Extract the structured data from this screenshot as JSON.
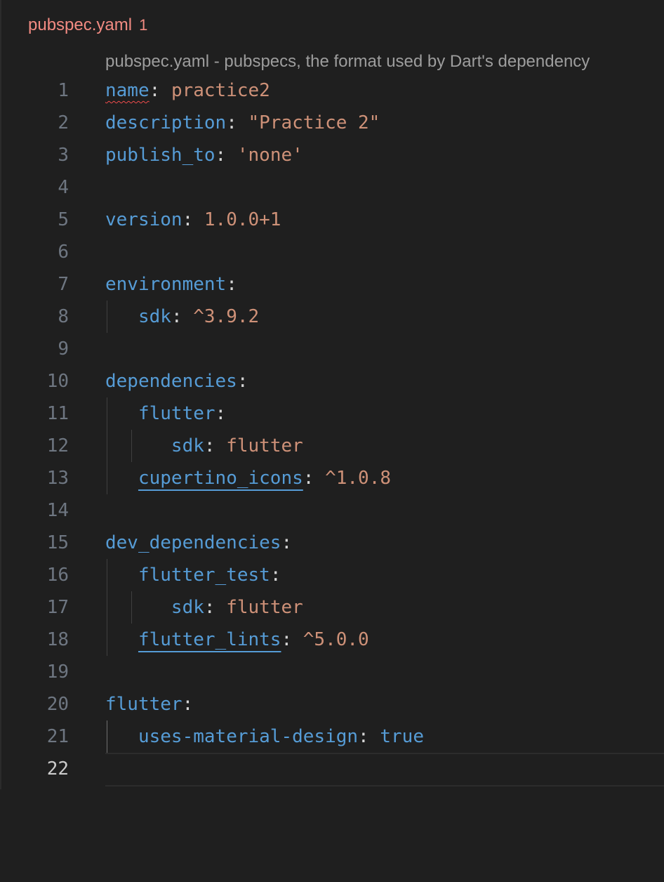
{
  "tab": {
    "filename": "pubspec.yaml",
    "problem_count": "1"
  },
  "schema_hint": "pubspec.yaml - pubspecs, the format used by Dart's dependency",
  "lines": [
    {
      "num": "1"
    },
    {
      "num": "2"
    },
    {
      "num": "3"
    },
    {
      "num": "4"
    },
    {
      "num": "5"
    },
    {
      "num": "6"
    },
    {
      "num": "7"
    },
    {
      "num": "8"
    },
    {
      "num": "9"
    },
    {
      "num": "10"
    },
    {
      "num": "11"
    },
    {
      "num": "12"
    },
    {
      "num": "13"
    },
    {
      "num": "14"
    },
    {
      "num": "15"
    },
    {
      "num": "16"
    },
    {
      "num": "17"
    },
    {
      "num": "18"
    },
    {
      "num": "19"
    },
    {
      "num": "20"
    },
    {
      "num": "21"
    },
    {
      "num": "22"
    }
  ],
  "code": {
    "l1_key": "name",
    "l1_val": "practice2",
    "l2_key": "description",
    "l2_val": "\"Practice 2\"",
    "l3_key": "publish_to",
    "l3_val": "'none'",
    "l5_key": "version",
    "l5_val": "1.0.0+1",
    "l7_key": "environment",
    "l8_key": "sdk",
    "l8_val": "^3.9.2",
    "l10_key": "dependencies",
    "l11_key": "flutter",
    "l12_key": "sdk",
    "l12_val": "flutter",
    "l13_key": "cupertino_icons",
    "l13_val": "^1.0.8",
    "l15_key": "dev_dependencies",
    "l16_key": "flutter_test",
    "l17_key": "sdk",
    "l17_val": "flutter",
    "l18_key": "flutter_lints",
    "l18_val": "^5.0.0",
    "l20_key": "flutter",
    "l21_key": "uses-material-design",
    "l21_val": "true",
    "colon": ":"
  },
  "colors": {
    "background": "#1f1f1f",
    "key": "#569cd6",
    "string_value": "#ce9178",
    "tab_error": "#f28b82",
    "line_number": "#6e7681"
  }
}
